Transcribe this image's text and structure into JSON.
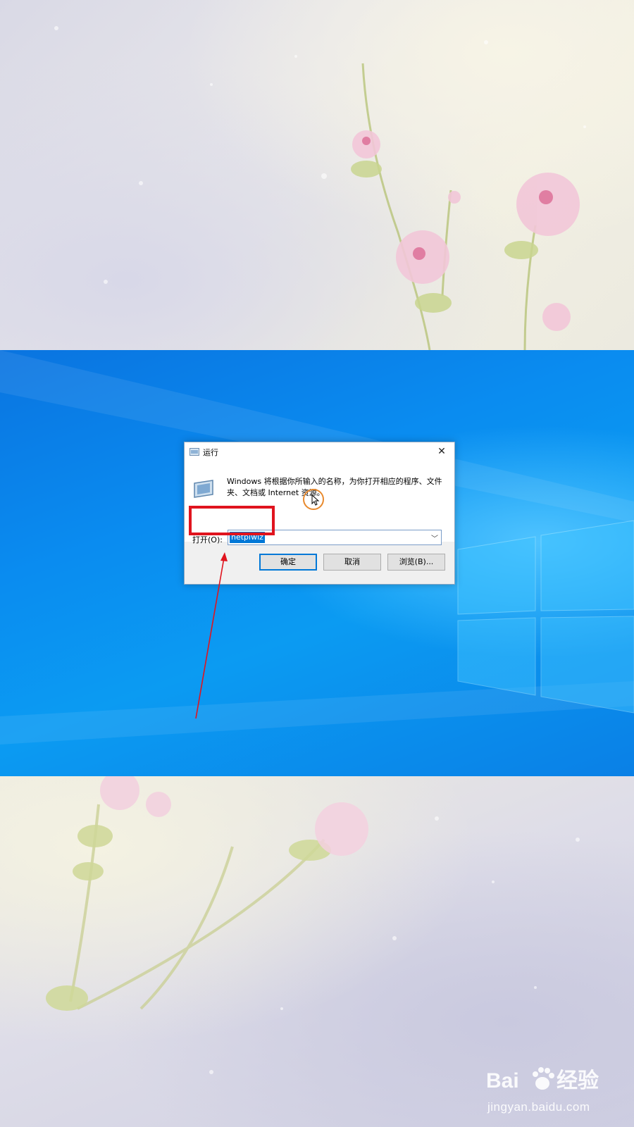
{
  "run_dialog": {
    "title": "运行",
    "close_glyph": "✕",
    "description": "Windows 将根据你所输入的名称，为你打开相应的程序、文件夹、文档或 Internet 资源。",
    "open_label": "打开(O):",
    "open_value": "netplwiz",
    "dropdown_glyph": "﹀",
    "buttons": {
      "ok": "确定",
      "cancel": "取消",
      "browse": "浏览(B)..."
    }
  },
  "annotations": {
    "highlight_color": "#e0141e",
    "cursor_ring_color": "#e88a2e"
  },
  "watermark": {
    "logo_text": "Bai du 经验",
    "url": "jingyan.baidu.com"
  },
  "colors": {
    "accent_selection": "#0078d7",
    "desktop_blue": "#0a8cf0"
  },
  "icons": [
    "run-app-icon",
    "close-icon",
    "chevron-down-icon",
    "mouse-cursor-icon",
    "baidu-paw-icon"
  ]
}
